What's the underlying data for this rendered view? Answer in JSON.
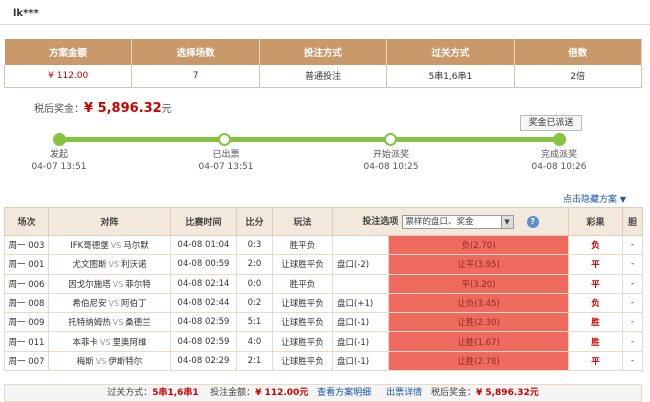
{
  "user": "lk***",
  "summary": {
    "headers": [
      "方案金额",
      "选择场数",
      "投注方式",
      "过关方式",
      "倍数"
    ],
    "values": [
      "¥ 112.00",
      "7",
      "普通投注",
      "5串1,6串1",
      "2倍"
    ]
  },
  "prize": {
    "label": "税后奖金：",
    "amount": "¥ 5,896.32",
    "unit": "元"
  },
  "audit_button": "奖金已派送",
  "steps": [
    {
      "name": "发起",
      "time": "04-07 13:51"
    },
    {
      "name": "已出票",
      "time": "04-07 13:51"
    },
    {
      "name": "开始派奖",
      "time": "04-08 10:25"
    },
    {
      "name": "完成派奖",
      "time": "04-08 10:26"
    }
  ],
  "hide_link": "点击隐藏方案",
  "details": {
    "headers": {
      "round": "场次",
      "match": "对阵",
      "time": "比赛时间",
      "score": "比分",
      "play": "玩法",
      "options": "投注选项",
      "select": "票样的盘口、奖金",
      "result": "彩果",
      "dan": "胆"
    },
    "rows": [
      {
        "round": "周一 003",
        "home": "IFK哥德堡",
        "away": "马尔默",
        "time": "04-08 01:04",
        "score": "0:3",
        "play": "胜平负",
        "handicap": "",
        "pick": "负(2.70)",
        "result": "负",
        "dan": "-"
      },
      {
        "round": "周一 001",
        "home": "尤文图斯",
        "away": "利沃诺",
        "time": "04-08 00:59",
        "score": "2:0",
        "play": "让球胜平负",
        "handicap": "盘口(-2)",
        "pick": "让平(3.95)",
        "result": "平",
        "dan": "-"
      },
      {
        "round": "周一 006",
        "home": "因戈尔施塔",
        "away": "菲尔特",
        "time": "04-08 02:14",
        "score": "0:0",
        "play": "胜平负",
        "handicap": "",
        "pick": "平(3.20)",
        "result": "平",
        "dan": "-"
      },
      {
        "round": "周一 008",
        "home": "希伯尼安",
        "away": "阿伯丁",
        "time": "04-08 02:44",
        "score": "0:2",
        "play": "让球胜平负",
        "handicap": "盘口(+1)",
        "pick": "让负(3.45)",
        "result": "负",
        "dan": "-"
      },
      {
        "round": "周一 009",
        "home": "托特纳姆热",
        "away": "桑德兰",
        "time": "04-08 02:59",
        "score": "5:1",
        "play": "让球胜平负",
        "handicap": "盘口(-1)",
        "pick": "让胜(2.30)",
        "result": "胜",
        "dan": "-"
      },
      {
        "round": "周一 011",
        "home": "本菲卡",
        "away": "里奥阿维",
        "time": "04-08 02:59",
        "score": "4:0",
        "play": "让球胜平负",
        "handicap": "盘口(-1)",
        "pick": "让胜(1.67)",
        "result": "胜",
        "dan": "-"
      },
      {
        "round": "周一 007",
        "home": "梅斯",
        "away": "伊斯特尔",
        "time": "04-08 02:29",
        "score": "2:1",
        "play": "让球胜平负",
        "handicap": "盘口(-1)",
        "pick": "让胜(2.78)",
        "result": "平",
        "dan": "-"
      }
    ]
  },
  "footer": {
    "pass_label": "过关方式：",
    "pass_value": "5串1,6串1",
    "bet_label": "投注金额：",
    "bet_value": "¥ 112.00元",
    "view_detail": "查看方案明细",
    "ticket_detail": "出票详情",
    "prize_label": "税后奖金：",
    "prize_value": "¥ 5,896.32元"
  },
  "colors": {
    "accent": "#c9996a",
    "progress": "#86c340",
    "highlight": "#ef6a5f",
    "link": "#1a55a6",
    "red": "#cc0000"
  }
}
